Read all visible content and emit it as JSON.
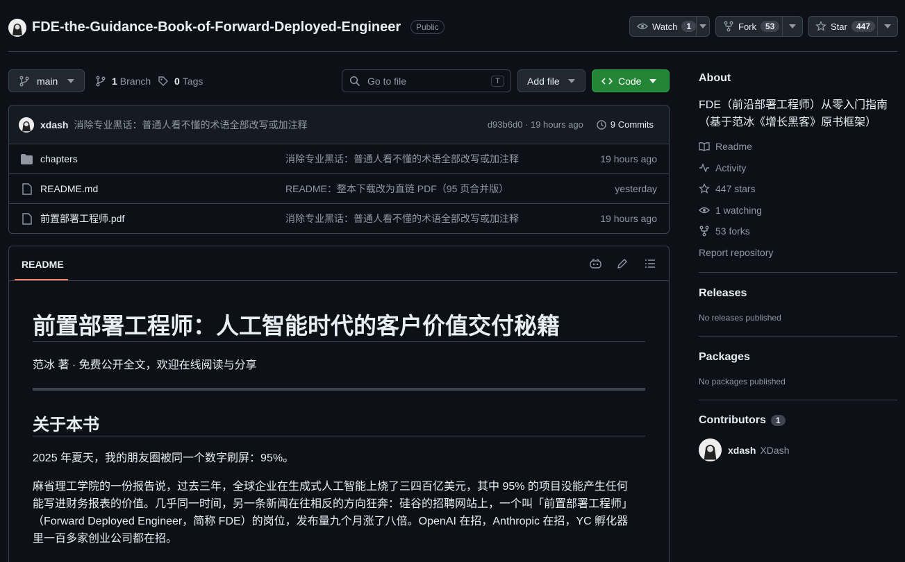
{
  "repo": {
    "name": "FDE-the-Guidance-Book-of-Forward-Deployed-Engineer",
    "visibility": "Public"
  },
  "actions": {
    "watch_label": "Watch",
    "watch_count": "1",
    "fork_label": "Fork",
    "fork_count": "53",
    "star_label": "Star",
    "star_count": "447"
  },
  "toolbar": {
    "branch": "main",
    "branch_count": "1",
    "branch_label": "Branch",
    "tag_count": "0",
    "tag_label": "Tags",
    "goto_placeholder": "Go to file",
    "goto_key": "T",
    "add_file": "Add file",
    "code": "Code"
  },
  "commit": {
    "author": "xdash",
    "message": "消除专业黑话：普通人看不懂的术语全部改写或加注释",
    "hash_time": "d93b6d0 · 19 hours ago",
    "commits": "9 Commits"
  },
  "files": [
    {
      "name": "chapters",
      "type": "folder",
      "message": "消除专业黑话：普通人看不懂的术语全部改写或加注释",
      "time": "19 hours ago"
    },
    {
      "name": "README.md",
      "type": "file",
      "message": "README：整本下载改为直链 PDF（95 页合并版）",
      "time": "yesterday"
    },
    {
      "name": "前置部署工程师.pdf",
      "type": "file",
      "message": "消除专业黑话：普通人看不懂的术语全部改写或加注释",
      "time": "19 hours ago"
    }
  ],
  "readme": {
    "tab": "README",
    "h1": "前置部署工程师：人工智能时代的客户价值交付秘籍",
    "subtitle": "范冰 著 · 免费公开全文，欢迎在线阅读与分享",
    "h2": "关于本书",
    "p1": "2025 年夏天，我的朋友圈被同一个数字刷屏：95%。",
    "p2": "麻省理工学院的一份报告说，过去三年，全球企业在生成式人工智能上烧了三四百亿美元，其中 95% 的项目没能产生任何能写进财务报表的价值。几乎同一时间，另一条新闻在往相反的方向狂奔：硅谷的招聘网站上，一个叫「前置部署工程师」（Forward Deployed Engineer，简称 FDE）的岗位，发布量九个月涨了八倍。OpenAI 在招，Anthropic 在招，YC 孵化器里一百多家创业公司都在招。"
  },
  "about": {
    "title": "About",
    "description": "FDE（前沿部署工程师）从零入门指南（基于范冰《增长黑客》原书框架）",
    "readme": "Readme",
    "activity": "Activity",
    "stars": "447 stars",
    "watching": "1 watching",
    "forks": "53 forks",
    "report": "Report repository"
  },
  "releases": {
    "title": "Releases",
    "empty": "No releases published"
  },
  "packages": {
    "title": "Packages",
    "empty": "No packages published"
  },
  "contributors": {
    "title": "Contributors",
    "count": "1",
    "login": "xdash",
    "name": "XDash"
  },
  "colors": {
    "bg": "#0d1117",
    "border": "#3d444d",
    "muted": "#9198a1",
    "green": "#238636",
    "accent_orange": "#f78166"
  }
}
